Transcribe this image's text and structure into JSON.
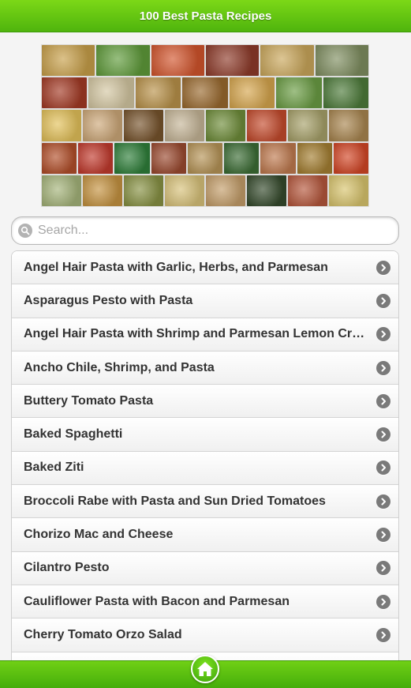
{
  "header": {
    "title": "100 Best Pasta Recipes"
  },
  "collage": {
    "rows": [
      [
        "#c8a04a",
        "#5f9b3a",
        "#d2552d",
        "#8e3b2a",
        "#caa75b",
        "#7f8e60"
      ],
      [
        "#a33a25",
        "#d4c7a2",
        "#b9924a",
        "#9a6a2f",
        "#d6a64e",
        "#6b9d44",
        "#4d7b3a"
      ],
      [
        "#e3c15a",
        "#cda879",
        "#77542d",
        "#c5b597",
        "#6f8d3a",
        "#c44b2d",
        "#a7a16a",
        "#a98650"
      ],
      [
        "#b24f2a",
        "#c23b2e",
        "#2f7f3a",
        "#9b4a30",
        "#b69457",
        "#3c6d35",
        "#bf7a4f",
        "#a47f32",
        "#d24626"
      ],
      [
        "#a5b47a",
        "#c59341",
        "#889244",
        "#d8c27a",
        "#c49e6a",
        "#354a2c",
        "#b5573c",
        "#d8c46d"
      ]
    ]
  },
  "search": {
    "placeholder": "Search..."
  },
  "recipes": [
    "Angel Hair Pasta with Garlic, Herbs, and Parmesan",
    "Asparagus Pesto with Pasta",
    "Angel Hair Pasta with Shrimp and Parmesan Lemon Cream Sauce",
    "Ancho Chile, Shrimp, and Pasta",
    "Buttery Tomato Pasta",
    "Baked Spaghetti",
    "Baked Ziti",
    "Broccoli Rabe with Pasta and Sun Dried Tomatoes",
    "Chorizo Mac and Cheese",
    "Cilantro Pesto",
    "Cauliflower Pasta with Bacon and Parmesan",
    "Cherry Tomato Orzo Salad",
    ""
  ],
  "colors": {
    "header_green": "#5cc211",
    "chevron_gray": "#7a7a7a",
    "text_dark": "#333333"
  },
  "icons": {
    "search": "search-icon",
    "chevron": "chevron-right-icon",
    "home": "home-icon"
  }
}
